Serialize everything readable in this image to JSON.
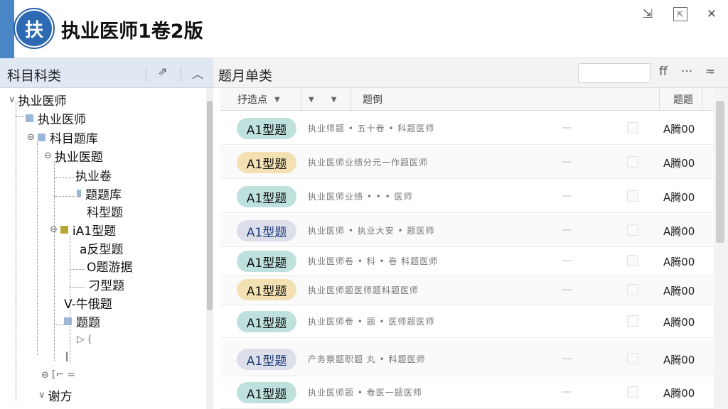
{
  "app": {
    "logo_char": "扶",
    "title": "执业医师1卷2版"
  },
  "window_controls": {
    "pin": "⇲",
    "restore": "⇱",
    "close": "✕"
  },
  "left_panel": {
    "title": "科目科类",
    "pin_icon": "⇗",
    "collapse_icon": "︿",
    "tree": [
      {
        "label": "执业医师",
        "expander": "∨",
        "box": "none"
      },
      {
        "label": "执业医师",
        "expander": "",
        "box": "blue"
      },
      {
        "label": "科目题库",
        "expander": "⊖",
        "box": "blue"
      },
      {
        "label": "执业医题",
        "expander": "⊖",
        "box": "none"
      },
      {
        "label": "执业卷",
        "expander": "",
        "box": "none"
      },
      {
        "label": "题题库",
        "expander": "",
        "box": "blue"
      },
      {
        "label": "科型题",
        "expander": "",
        "box": "none"
      },
      {
        "label": "iA1型题",
        "expander": "⊖",
        "box": "gold"
      },
      {
        "label": "a反型题",
        "expander": "",
        "box": "none"
      },
      {
        "label": "O题游据",
        "expander": "",
        "box": "none"
      },
      {
        "label": "刁型题",
        "expander": "",
        "box": "none"
      },
      {
        "label": "V-牛俄题",
        "expander": "",
        "box": "none"
      },
      {
        "label": "题题",
        "expander": "",
        "box": "blue"
      },
      {
        "label": "▷ ⟨",
        "expander": "",
        "box": "none"
      },
      {
        "label": "ǀ",
        "expander": "",
        "box": "none"
      },
      {
        "label": "[⌐ =",
        "expander": "⊖",
        "box": "none"
      },
      {
        "label": "谢方",
        "expander": "∨",
        "box": "none"
      }
    ]
  },
  "right_panel": {
    "title": "题月单类",
    "search_placeholder": "",
    "icons": {
      "filter": "ff",
      "more": "···",
      "collapse": "≈"
    },
    "columns": [
      {
        "label": "抒造点",
        "arrow": "▼"
      },
      {
        "label": "▼",
        "arrow": "▼"
      },
      {
        "label": "题倒",
        "arrow": ""
      },
      {
        "label": "题题",
        "arrow": ""
      }
    ],
    "rows": [
      {
        "tag": "A1型题",
        "tag_color": "#bfe1de",
        "text": "执业师题 • 五十卷 • 科题医师",
        "dash": "—",
        "value": "A腾00"
      },
      {
        "tag": "A1型题",
        "tag_color": "#f4e1b3",
        "text": "执业医师业绩分元一作题医师",
        "dash": "—",
        "value": "A腾00"
      },
      {
        "tag": "A1型题",
        "tag_color": "#bfe1de",
        "text": "执业医师业绩 • • • 医师",
        "dash": "—",
        "value": "A腾00"
      },
      {
        "tag": "A1型题",
        "tag_color": "#dcdfe9",
        "text": "执业医师 • 执业大安 • 题医师",
        "dash": "—",
        "value": "A腾00"
      },
      {
        "tag": "A1型题",
        "tag_color": "#bfe1de",
        "text": "执业医师卷 • 科 • 卷 科题医师",
        "dash": "—",
        "value": "A腾00"
      },
      {
        "tag": "A1型题",
        "tag_color": "#f4e1b3",
        "text": "执业医师题医师题科题医师",
        "dash": "—",
        "value": "A腾00"
      },
      {
        "tag": "A1型题",
        "tag_color": "#bfe1de",
        "text": "执业医师卷 • 题 • 医师题医师",
        "dash": "",
        "value": "A腾00"
      },
      {
        "tag": "A1型题",
        "tag_color": "#dcdfe9",
        "text": "产务察题职题 丸 • 科题医师",
        "dash": "—",
        "value": "A腾00"
      },
      {
        "tag": "A1型题",
        "tag_color": "#bfe1de",
        "text": "执业医师题 • 卷医一题医师",
        "dash": "—",
        "value": "A腾00"
      }
    ]
  },
  "colors": {
    "accent": "#4a86c5",
    "header_blue": "#dfe8f3",
    "tag_teal": "#bfe1de",
    "tag_gold": "#f4e1b3",
    "tag_lavender": "#dcdfe9"
  }
}
